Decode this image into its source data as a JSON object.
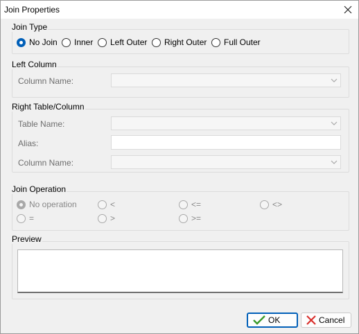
{
  "window": {
    "title": "Join Properties"
  },
  "join_type": {
    "legend": "Join Type",
    "options": [
      "No Join",
      "Inner",
      "Left Outer",
      "Right Outer",
      "Full Outer"
    ],
    "selected": "No Join"
  },
  "left_column": {
    "legend": "Left Column",
    "column_name_label": "Column Name:",
    "column_name_value": ""
  },
  "right_table_column": {
    "legend": "Right Table/Column",
    "table_name_label": "Table Name:",
    "table_name_value": "",
    "alias_label": "Alias:",
    "alias_value": "",
    "column_name_label": "Column Name:",
    "column_name_value": ""
  },
  "join_operation": {
    "legend": "Join Operation",
    "options": [
      "No operation",
      "<",
      "<=",
      "<>",
      "=",
      ">",
      ">="
    ],
    "selected": "No operation"
  },
  "preview": {
    "legend": "Preview",
    "text": ""
  },
  "buttons": {
    "ok": "OK",
    "cancel": "Cancel"
  },
  "colors": {
    "accent": "#005fb8",
    "ok_check": "#3a9a2a",
    "cancel_x": "#d9302c"
  }
}
